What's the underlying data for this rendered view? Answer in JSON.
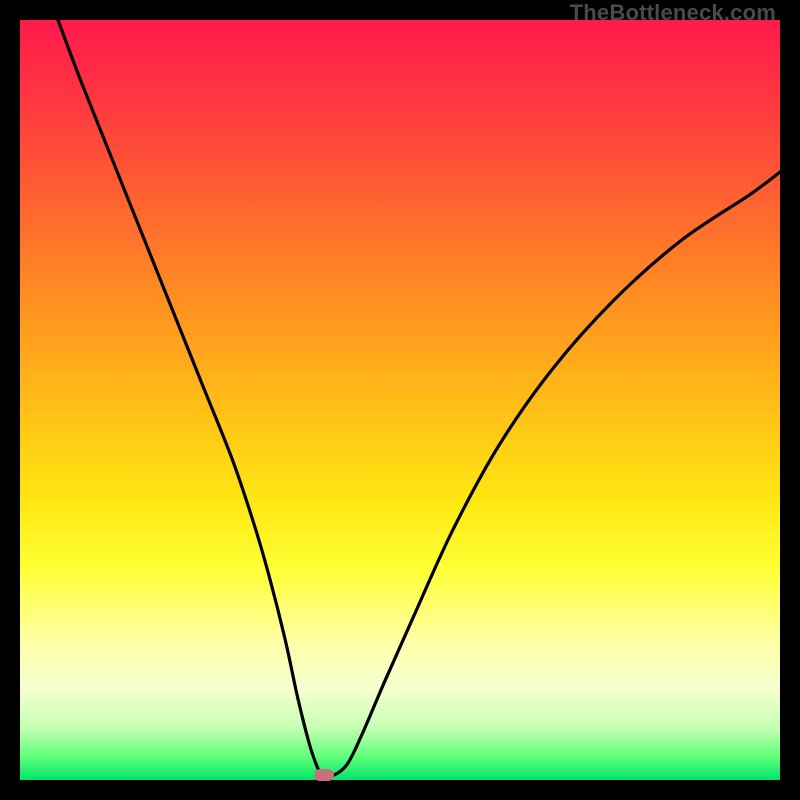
{
  "watermark": "TheBottleneck.com",
  "chart_data": {
    "type": "line",
    "title": "",
    "xlabel": "",
    "ylabel": "",
    "xlim": [
      0,
      100
    ],
    "ylim": [
      0,
      100
    ],
    "grid": false,
    "legend": false,
    "background_gradient": {
      "direction": "vertical",
      "stops": [
        {
          "pos": 0.0,
          "color": "#ff1a4d"
        },
        {
          "pos": 0.5,
          "color": "#ffc216"
        },
        {
          "pos": 0.75,
          "color": "#ffff66"
        },
        {
          "pos": 1.0,
          "color": "#00e56a"
        }
      ]
    },
    "series": [
      {
        "name": "bottleneck-curve",
        "color": "#000000",
        "x": [
          5,
          8,
          12,
          16,
          20,
          24,
          28,
          31,
          33,
          35,
          36.5,
          38,
          39,
          39.8,
          41,
          43,
          45,
          48,
          52,
          57,
          63,
          70,
          78,
          87,
          96,
          100
        ],
        "y": [
          100,
          92,
          82,
          72,
          62,
          52,
          42,
          33,
          26,
          18,
          11,
          5,
          2,
          0.5,
          0.5,
          2,
          6,
          13,
          22,
          33,
          44,
          54,
          63,
          71,
          77,
          80
        ]
      }
    ],
    "markers": [
      {
        "name": "min-point",
        "x": 40,
        "y": 0.6,
        "shape": "pill",
        "color": "#c6727c"
      }
    ]
  }
}
